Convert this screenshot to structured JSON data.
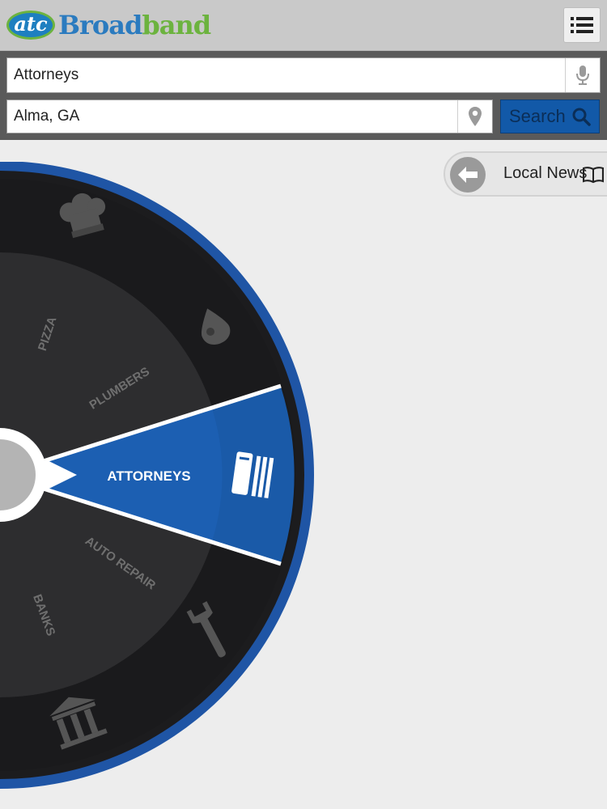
{
  "header": {
    "logo_short": "atc",
    "logo_word_1": "Broad",
    "logo_word_2": "band",
    "menu_icon": "list-icon"
  },
  "search": {
    "query_value": "Attorneys",
    "location_value": "Alma, GA",
    "search_label": "Search",
    "mic_icon": "microphone-icon",
    "location_icon": "map-pin-icon",
    "search_icon": "magnifier-icon"
  },
  "news": {
    "label": "Local News",
    "back_icon": "arrow-left-icon",
    "book_icon": "book-icon"
  },
  "wheel": {
    "selected": "ATTORNEYS",
    "categories": [
      "PIZZA",
      "PLUMBERS",
      "AUTO REPAIR",
      "BANKS"
    ],
    "colors": {
      "accent": "#1a5aa8",
      "ring": "#1f55a5",
      "dark": "#1c1c1e",
      "inner": "#2d2d2f"
    }
  }
}
